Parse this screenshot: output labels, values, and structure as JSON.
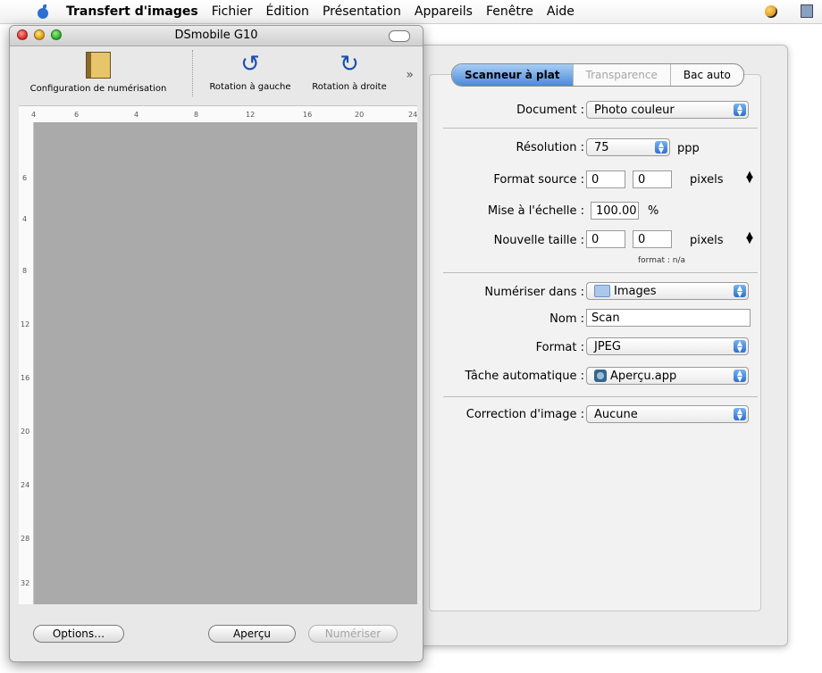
{
  "menubar": {
    "app_name": "Transfert d'images",
    "items": [
      "Fichier",
      "Édition",
      "Présentation",
      "Appareils",
      "Fenêtre",
      "Aide"
    ]
  },
  "window": {
    "title": "DSmobile G10",
    "toolbar": {
      "configure": "Configuration de numérisation",
      "rotate_left": "Rotation à gauche",
      "rotate_right": "Rotation à droite",
      "overflow": "»"
    },
    "ruler": {
      "h_ticks": [
        "4",
        "6",
        "4",
        "8",
        "12",
        "16",
        "20",
        "24"
      ],
      "v_ticks": [
        "6",
        "4",
        "8",
        "12",
        "16",
        "20",
        "24",
        "28",
        "32"
      ]
    },
    "buttons": {
      "options": "Options…",
      "preview": "Aperçu",
      "scan": "Numériser"
    }
  },
  "panel": {
    "tabs": [
      "Scanneur à plat",
      "Transparence",
      "Bac auto"
    ],
    "document_label": "Document :",
    "document_value": "Photo couleur",
    "resolution_label": "Résolution :",
    "resolution_value": "75",
    "resolution_unit": "ppp",
    "source_label": "Format source :",
    "source_w": "0",
    "source_h": "0",
    "source_unit": "pixels",
    "scale_label": "Mise à l'échelle :",
    "scale_value": "100.00",
    "scale_unit": "%",
    "newsize_label": "Nouvelle taille :",
    "newsize_w": "0",
    "newsize_h": "0",
    "newsize_unit": "pixels",
    "format_note": "format : n/a",
    "scanto_label": "Numériser dans :",
    "scanto_value": "Images",
    "name_label": "Nom :",
    "name_value": "Scan",
    "format_label": "Format :",
    "format_value": "JPEG",
    "task_label": "Tâche automatique :",
    "task_value": "Aperçu.app",
    "correction_label": "Correction d'image :",
    "correction_value": "Aucune"
  }
}
